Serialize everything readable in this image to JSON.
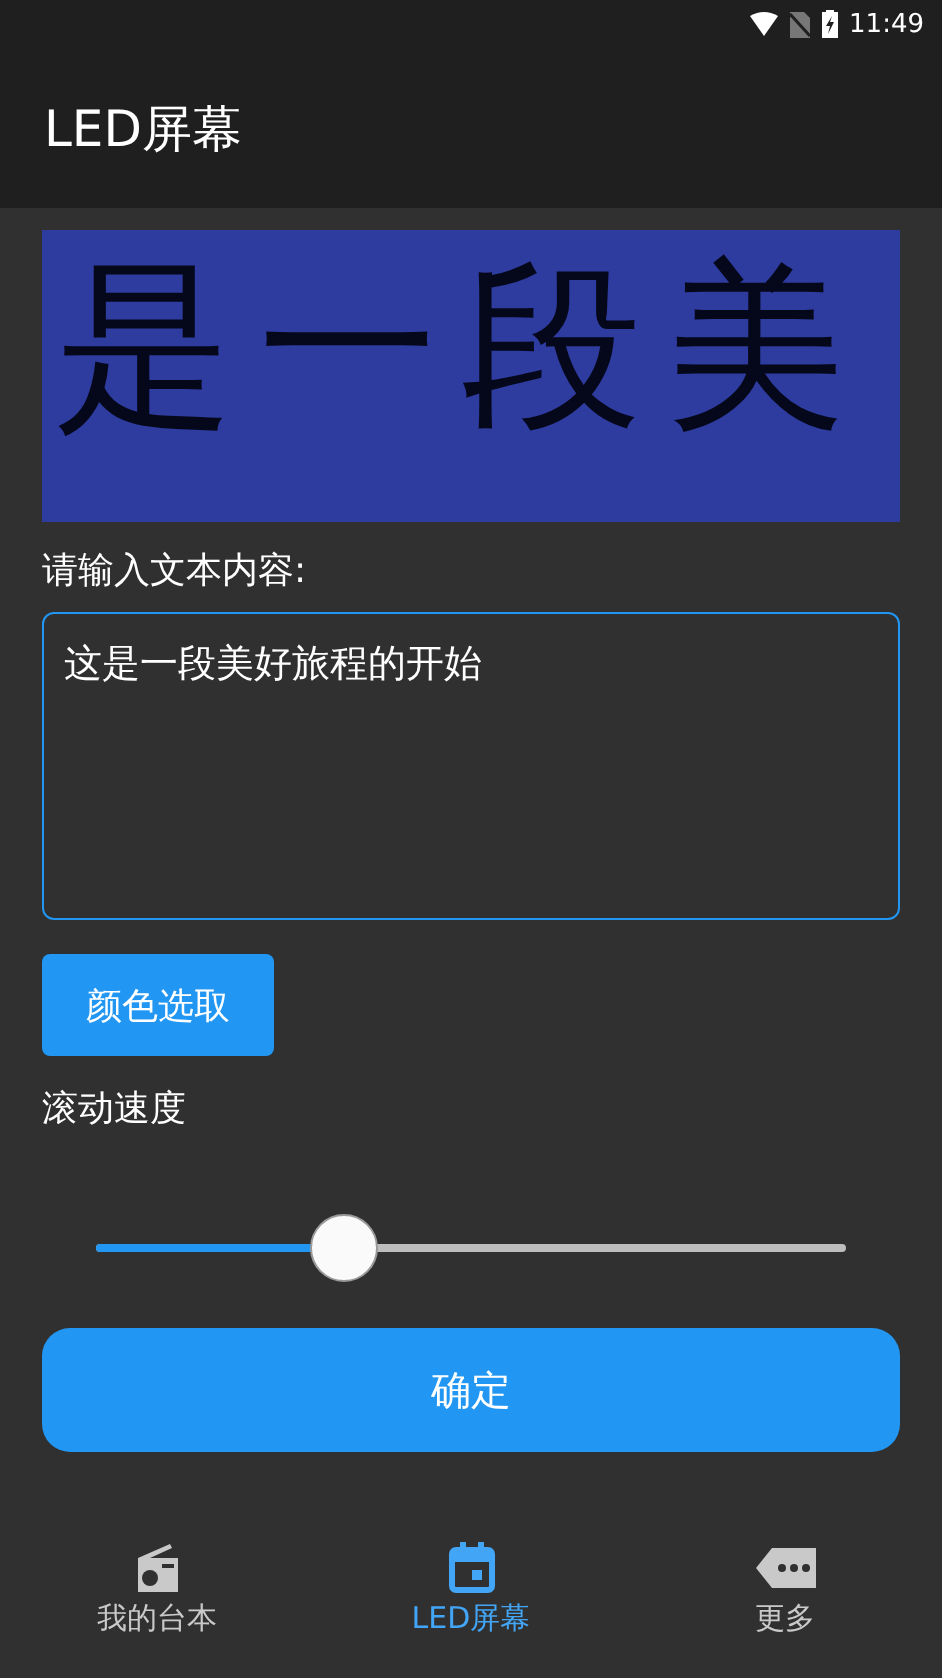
{
  "status_bar": {
    "time": "11:49"
  },
  "app_bar": {
    "title": "LED屏幕"
  },
  "led_display": {
    "text": "是一段美"
  },
  "input": {
    "label": "请输入文本内容:",
    "value": "这是一段美好旅程的开始"
  },
  "color_button": {
    "label": "颜色选取"
  },
  "speed": {
    "label": "滚动速度",
    "level": 0.33
  },
  "confirm_button": {
    "label": "确定"
  },
  "bottom_nav": [
    {
      "kind": "radio",
      "label": "我的台本",
      "selected": false
    },
    {
      "kind": "calendar",
      "label": "LED屏幕",
      "selected": true
    },
    {
      "kind": "more",
      "label": "更多",
      "selected": false
    }
  ]
}
